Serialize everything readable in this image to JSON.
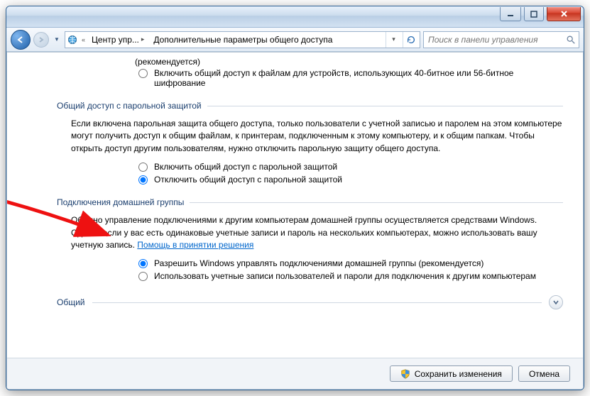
{
  "titlebar": {},
  "nav": {
    "crumb1": "Центр упр...",
    "crumb2": "Дополнительные параметры общего доступа"
  },
  "search": {
    "placeholder": "Поиск в панели управления"
  },
  "content": {
    "rec_suffix": "(рекомендуется)",
    "enc_opt": "Включить общий доступ к файлам для устройств, использующих 40-битное или 56-битное шифрование",
    "sec_password": "Общий доступ с парольной защитой",
    "pwd_para": "Если включена парольная защита общего доступа, только пользователи с учетной записью и паролем на этом компьютере могут получить доступ к общим файлам, к принтерам, подключенным к этому компьютеру, и к общим папкам. Чтобы открыть доступ другим пользователям, нужно отключить парольную защиту общего доступа.",
    "pwd_on": "Включить общий доступ с парольной защитой",
    "pwd_off": "Отключить общий доступ с парольной защитой",
    "sec_homegroup": "Подключения домашней группы",
    "hg_para_1": "Обычно управление подключениями к другим компьютерам домашней группы осуществляется средствами Windows. Однако если у вас есть одинаковые учетные записи и пароль на нескольких компьютерах, можно использовать вашу учетную запись. ",
    "hg_link": "Помощь в принятии решения",
    "hg_opt1": "Разрешить Windows управлять подключениями домашней группы (рекомендуется)",
    "hg_opt2": "Использовать учетные записи пользователей и пароли для подключения к другим компьютерам",
    "sec_common": "Общий"
  },
  "footer": {
    "save": "Сохранить изменения",
    "cancel": "Отмена"
  }
}
